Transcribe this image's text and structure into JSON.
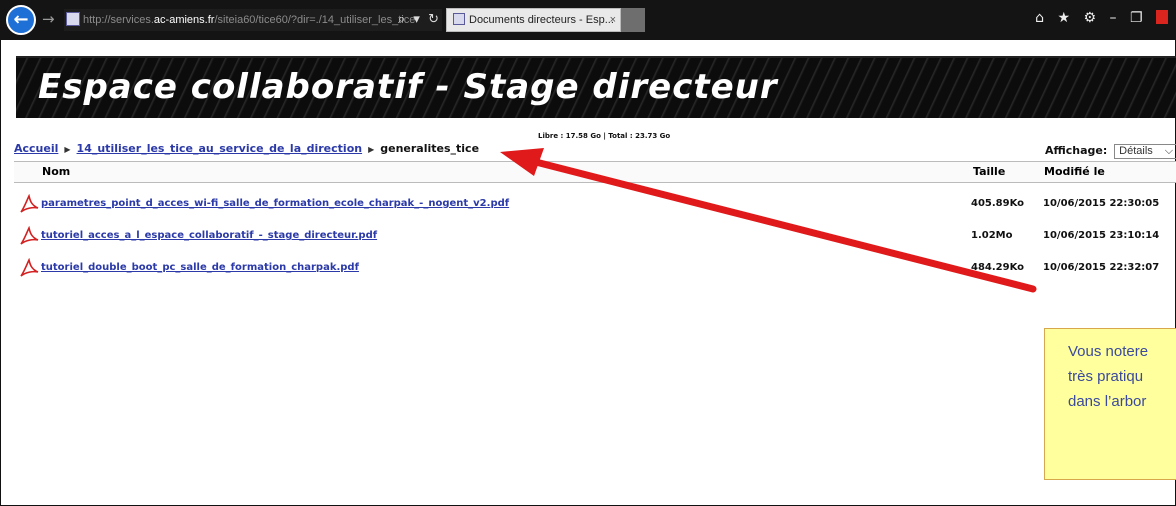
{
  "browser": {
    "back_glyph": "←",
    "forward_glyph": "→",
    "url_prefix": "http://services.",
    "url_domain": "ac-amiens.fr",
    "url_suffix": "/siteia60/tice60/?dir=./14_utiliser_les_tice",
    "addr_tools": "⌕ ▾ ↻",
    "tab_title": "Documents directeurs - Esp...",
    "tab_close": "×",
    "icons": [
      "home-icon",
      "favorites-icon",
      "settings-icon"
    ],
    "window_controls": [
      "minimize-icon",
      "restore-icon",
      "close-icon"
    ]
  },
  "banner": {
    "title": "Espace collaboratif - Stage directeur"
  },
  "quota": "Libre : 17.58 Go | Total : 23.73 Go",
  "breadcrumb": {
    "items": [
      "Accueil",
      "14_utiliser_les_tice_au_service_de_la_direction"
    ],
    "current": "generalites_tice",
    "separator": "▶"
  },
  "view": {
    "label": "Affichage:",
    "value": "Détails"
  },
  "table": {
    "headers": {
      "name": "Nom",
      "size": "Taille",
      "modified": "Modifié le"
    },
    "rows": [
      {
        "name": "parametres_point_d_acces_wi-fi_salle_de_formation_ecole_charpak_-_nogent_v2.pdf",
        "size": "405.89Ko",
        "date": "10/06/2015 22:30:05"
      },
      {
        "name": "tutoriel_acces_a_l_espace_collaboratif_-_stage_directeur.pdf",
        "size": "1.02Mo",
        "date": "10/06/2015 23:10:14"
      },
      {
        "name": "tutoriel_double_boot_pc_salle_de_formation_charpak.pdf",
        "size": "484.29Ko",
        "date": "10/06/2015 22:32:07"
      }
    ]
  },
  "callout": {
    "lines": [
      "Vous notere",
      "très pratiqu",
      "dans l’arbor"
    ]
  },
  "colors": {
    "link": "#2b3aa8",
    "arrow": "#e0191a",
    "callout_bg": "#ffff9e",
    "callout_text": "#3b4a9c"
  }
}
